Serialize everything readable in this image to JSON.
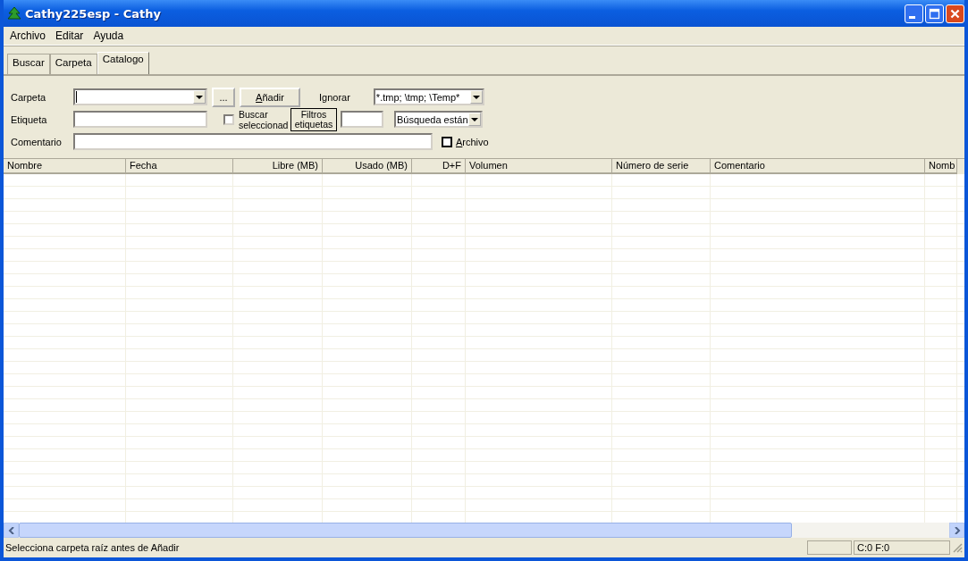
{
  "window": {
    "title": "Cathy225esp - Cathy"
  },
  "menu": [
    "Archivo",
    "Editar",
    "Ayuda"
  ],
  "tabs": [
    {
      "label": "Buscar",
      "selected": false
    },
    {
      "label": "Carpeta",
      "selected": false
    },
    {
      "label": "Catalogo",
      "selected": true
    }
  ],
  "form": {
    "carpeta_label": "Carpeta",
    "browse_button": "...",
    "add_button": "Añadir",
    "ignore_label": "Ignorar",
    "ignore_value": "*.tmp; \\tmp; \\Temp*",
    "etiqueta_label": "Etiqueta",
    "search_selected": {
      "label": "Buscar seleccionad",
      "checked": false,
      "kind": "sunken"
    },
    "filter_button": "Filtros etiquetas",
    "search_mode": "Búsqueda están",
    "comentario_label": "Comentario",
    "archive": {
      "label": "Archivo",
      "checked": false,
      "kind": "flat"
    }
  },
  "table": {
    "columns": [
      {
        "label": "Nombre"
      },
      {
        "label": "Fecha"
      },
      {
        "label": "Libre (MB)"
      },
      {
        "label": "Usado (MB)"
      },
      {
        "label": "D+F"
      },
      {
        "label": "Volumen"
      },
      {
        "label": "Número de serie"
      },
      {
        "label": "Comentario"
      },
      {
        "label": "Nomb"
      }
    ]
  },
  "status_bar": {
    "message": "Selecciona carpeta raíz antes de Añadir",
    "counts": "C:0 F:0"
  }
}
